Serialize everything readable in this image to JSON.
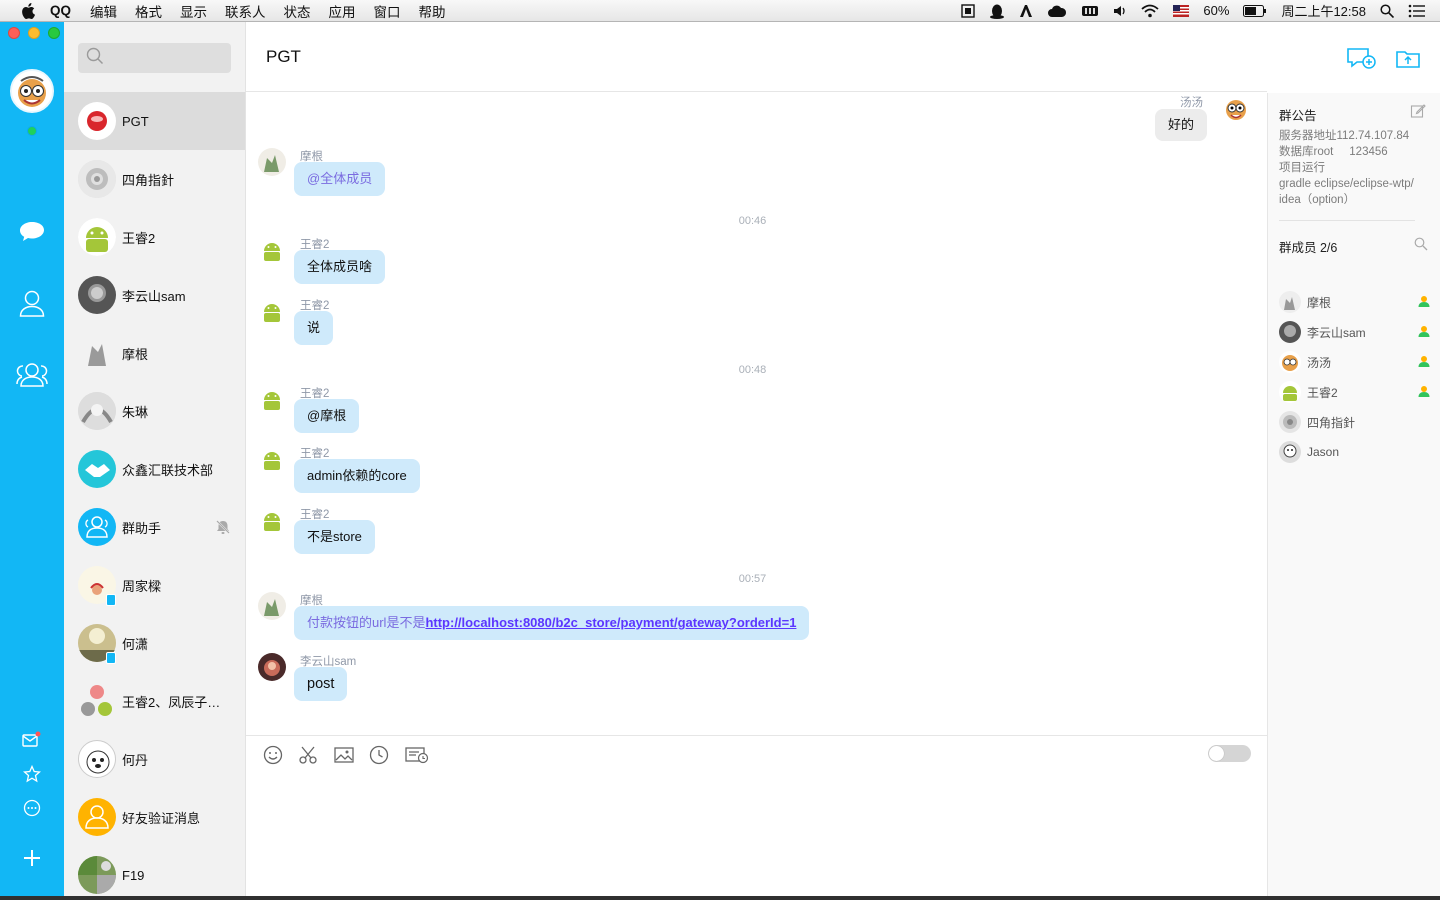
{
  "menubar": {
    "app": "QQ",
    "items": [
      "编辑",
      "格式",
      "显示",
      "联系人",
      "状态",
      "应用",
      "窗口",
      "帮助"
    ],
    "battery": "60%",
    "clock": "周二上午12:58"
  },
  "search": {
    "placeholder": ""
  },
  "conversations": [
    {
      "name": "PGT",
      "active": true
    },
    {
      "name": "四角指針"
    },
    {
      "name": "王睿2"
    },
    {
      "name": "李云山sam"
    },
    {
      "name": "摩根"
    },
    {
      "name": "朱琳"
    },
    {
      "name": "众鑫汇联技术部"
    },
    {
      "name": "群助手",
      "muted": true
    },
    {
      "name": "周家樑",
      "mobile": true
    },
    {
      "name": "何潇",
      "mobile": true
    },
    {
      "name": "王睿2、凤辰子…"
    },
    {
      "name": "何丹"
    },
    {
      "name": "好友验证消息"
    },
    {
      "name": "F19"
    }
  ],
  "chat": {
    "title": "PGT",
    "self_message": {
      "sender": "汤汤",
      "text": "好的"
    },
    "messages": [
      {
        "sender": "摩根",
        "text": "@全体成员"
      },
      {
        "time": "00:46"
      },
      {
        "sender": "王睿2",
        "text": "全体成员啥"
      },
      {
        "sender": "王睿2",
        "text": "说"
      },
      {
        "time": "00:48"
      },
      {
        "sender": "王睿2",
        "text": "@摩根"
      },
      {
        "sender": "王睿2",
        "text": "admin依赖的core"
      },
      {
        "sender": "王睿2",
        "text": "不是store"
      },
      {
        "time": "00:57"
      },
      {
        "sender": "摩根",
        "prefix": "付款按钮的url是不是",
        "link": "http://localhost:8080/b2c_store/payment/gateway?orderId=1"
      },
      {
        "sender": "李云山sam",
        "text": "post"
      }
    ]
  },
  "side": {
    "notice_title": "群公告",
    "notice_lines": [
      "服务器地址112.74.107.84",
      "数据库root     123456",
      "项目运行",
      "gradle eclipse/eclipse-wtp/",
      "idea（option）"
    ],
    "members_title": "群成员 2/6",
    "members": [
      {
        "name": "摩根",
        "online": true
      },
      {
        "name": "李云山sam",
        "online": true
      },
      {
        "name": "汤汤",
        "online": true
      },
      {
        "name": "王睿2",
        "online": true
      },
      {
        "name": "四角指針",
        "online": false
      },
      {
        "name": "Jason",
        "online": false
      }
    ]
  },
  "colors": {
    "rail": "#12b7f5",
    "bubble_in": "#cfeafb",
    "bubble_out": "#ececec",
    "link": "#5b36ff"
  }
}
